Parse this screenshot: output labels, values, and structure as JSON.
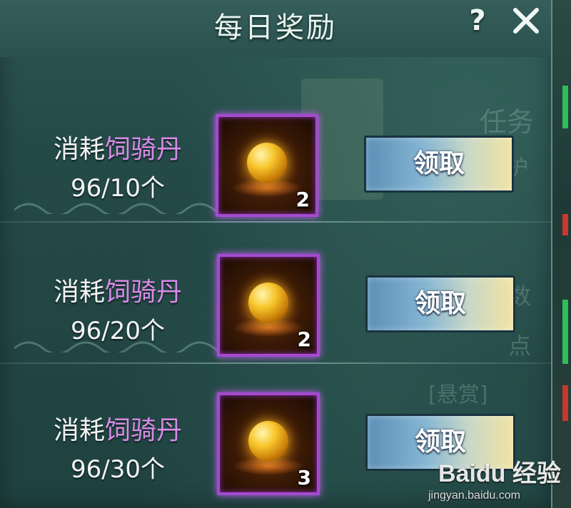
{
  "header": {
    "title": "每日奖励",
    "help_label": "?"
  },
  "background_text": [
    "任务",
    "护",
    "数",
    "点",
    "[悬赏]"
  ],
  "rewards": [
    {
      "req_prefix": "消耗",
      "req_item": "饲骑丹",
      "progress": "96/10个",
      "reward_qty": "2",
      "button_label": "领取"
    },
    {
      "req_prefix": "消耗",
      "req_item": "饲骑丹",
      "progress": "96/20个",
      "reward_qty": "2",
      "button_label": "领取"
    },
    {
      "req_prefix": "消耗",
      "req_item": "饲骑丹",
      "progress": "96/30个",
      "reward_qty": "3",
      "button_label": "领取"
    }
  ],
  "watermark": {
    "logo": "Baidu 经验",
    "url": "jingyan.baidu.com"
  },
  "colors": {
    "panel": "#244a48",
    "item_highlight": "#d98ae8",
    "slot_border": "#a54ad0"
  }
}
